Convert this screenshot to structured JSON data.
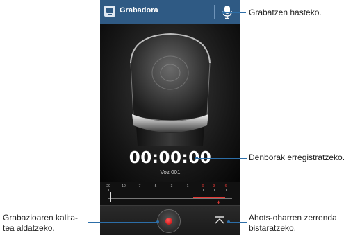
{
  "app": {
    "title": "Grabadora"
  },
  "recorder": {
    "timer": "00:00:00",
    "file_name": "Voz 001"
  },
  "quality": {
    "labels": [
      "20",
      "10",
      "7",
      "5",
      "3",
      "1",
      "0",
      "3",
      "6"
    ],
    "highlight_from_index": 6
  },
  "callouts": {
    "record": "Grabatzen hasteko.",
    "timer": "Denborak erregistratzeko.",
    "quality": "Grabazioaren kalita-\ntea aldatzeko.",
    "list": "Ahots-oharren zerrenda\nbistaratzeko."
  },
  "colors": {
    "appbar": "#2f5a84",
    "accent_red": "#e53935",
    "callout_line": "#2c6ea8"
  },
  "icons": [
    "recorder-app-icon",
    "microphone-icon",
    "record-dot-icon",
    "list-chevron-icon"
  ]
}
